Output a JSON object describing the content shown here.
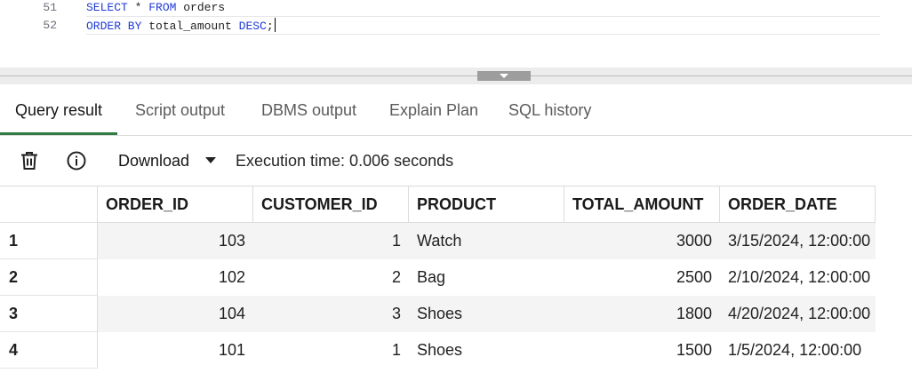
{
  "editor": {
    "lines": [
      {
        "number": "51",
        "tokens": [
          {
            "kw": "SELECT"
          },
          {
            "txt": " * "
          },
          {
            "kw": "FROM"
          },
          {
            "txt": " orders"
          }
        ]
      },
      {
        "number": "52",
        "tokens": [
          {
            "kw": "ORDER BY"
          },
          {
            "txt": " total_amount "
          },
          {
            "kw": "DESC"
          },
          {
            "txt": ";"
          }
        ]
      }
    ],
    "keyword_color": "#1f3bd6"
  },
  "tabs": [
    {
      "label": "Query result",
      "active": true
    },
    {
      "label": "Script output",
      "active": false
    },
    {
      "label": "DBMS output",
      "active": false
    },
    {
      "label": "Explain Plan",
      "active": false
    },
    {
      "label": "SQL history",
      "active": false
    }
  ],
  "toolbar": {
    "delete_icon": "trash-icon",
    "info_icon": "info-icon",
    "download_label": "Download",
    "execution_time": "Execution time: 0.006 seconds"
  },
  "grid": {
    "columns": [
      "ORDER_ID",
      "CUSTOMER_ID",
      "PRODUCT",
      "TOTAL_AMOUNT",
      "ORDER_DATE"
    ],
    "rows": [
      {
        "row_number": "1",
        "cells": [
          "103",
          "1",
          "Watch",
          "3000",
          "3/15/2024, 12:00:00"
        ]
      },
      {
        "row_number": "2",
        "cells": [
          "102",
          "2",
          "Bag",
          "2500",
          "2/10/2024, 12:00:00"
        ]
      },
      {
        "row_number": "3",
        "cells": [
          "104",
          "3",
          "Shoes",
          "1800",
          "4/20/2024, 12:00:00"
        ]
      },
      {
        "row_number": "4",
        "cells": [
          "101",
          "1",
          "Shoes",
          "1500",
          "1/5/2024, 12:00:00"
        ]
      }
    ]
  },
  "colors": {
    "active_tab_underline": "#2f7d45",
    "zebra_stripe": "#f4f4f4"
  }
}
